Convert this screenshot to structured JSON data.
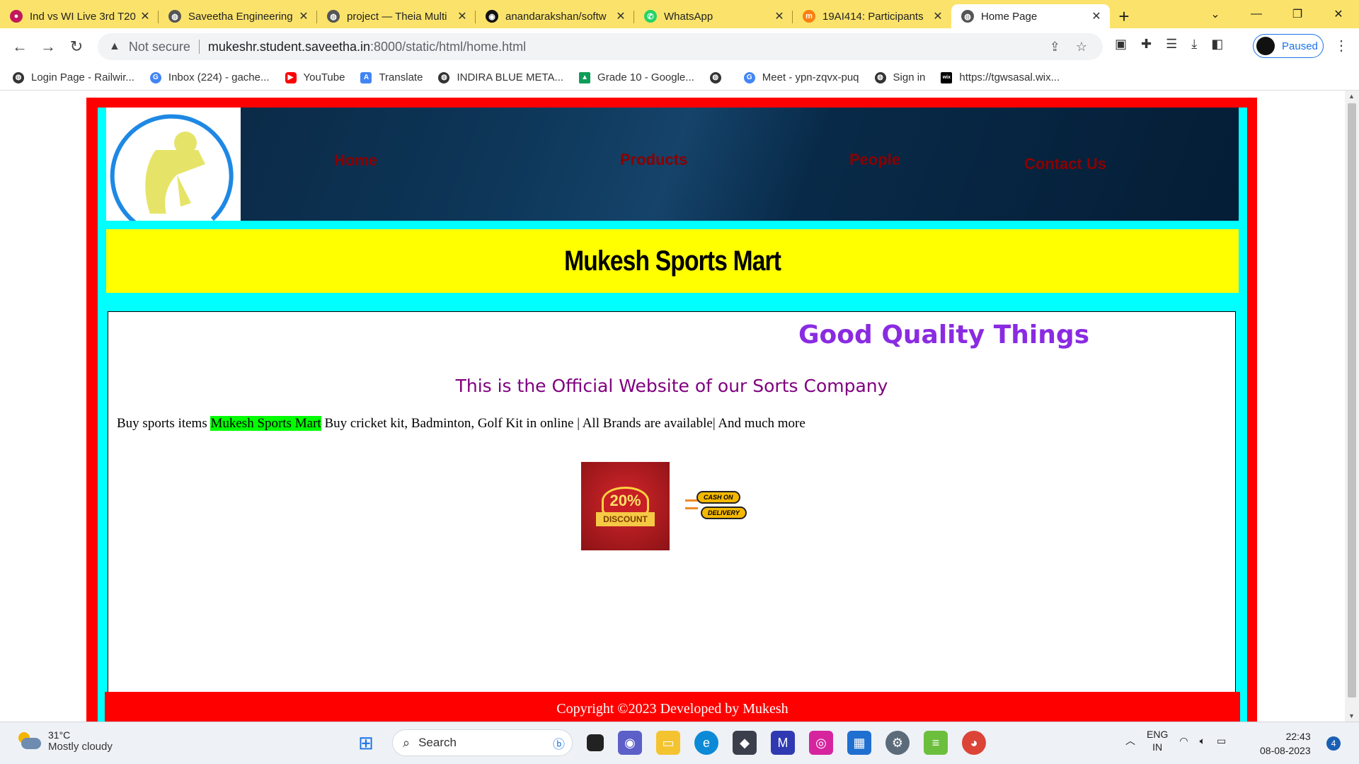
{
  "tabs": [
    {
      "title": "Ind vs WI Live 3rd T20",
      "icon": "cricket-icon",
      "color": "#c2185b"
    },
    {
      "title": "Saveetha Engineering",
      "icon": "globe-icon",
      "color": "#555555"
    },
    {
      "title": "project — Theia Multi",
      "icon": "globe-icon",
      "color": "#555555"
    },
    {
      "title": "anandarakshan/softw",
      "icon": "github-icon",
      "color": "#111111"
    },
    {
      "title": "WhatsApp",
      "icon": "whatsapp-icon",
      "color": "#25d366"
    },
    {
      "title": "19AI414: Participants",
      "icon": "moodle-icon",
      "color": "#f98012"
    },
    {
      "title": "Home Page",
      "icon": "globe-icon",
      "color": "#555555"
    }
  ],
  "address": {
    "security": "Not secure",
    "host": "mukeshr.student.saveetha.in",
    "path": ":8000/static/html/home.html"
  },
  "profile": {
    "status": "Paused"
  },
  "bookmarks": [
    {
      "label": "Login Page - Railwir...",
      "icon": "globe-icon",
      "color": "#333333"
    },
    {
      "label": "Inbox (224) - gache...",
      "icon": "google-icon",
      "color": "#4285f4"
    },
    {
      "label": "YouTube",
      "icon": "youtube-icon",
      "color": "#ff0000"
    },
    {
      "label": "Translate",
      "icon": "translate-icon",
      "color": "#4285f4"
    },
    {
      "label": "INDIRA BLUE META...",
      "icon": "globe-icon",
      "color": "#333333"
    },
    {
      "label": "Grade 10 - Google...",
      "icon": "drive-icon",
      "color": "#0f9d58"
    },
    {
      "label": "",
      "icon": "globe-icon",
      "color": "#333333"
    },
    {
      "label": "Meet - ypn-zqvx-puq",
      "icon": "google-icon",
      "color": "#4285f4"
    },
    {
      "label": "Sign in",
      "icon": "globe-icon",
      "color": "#333333"
    },
    {
      "label": "https://tgwsasal.wix...",
      "icon": "wix-icon",
      "color": "#000000"
    }
  ],
  "site": {
    "nav": [
      "Home",
      "Products",
      "People",
      "Contact Us"
    ],
    "title": "Mukesh Sports Mart",
    "heading": "Good Quality Things",
    "official": "This is the Official Website of our Sorts Company",
    "desc_before": "Buy sports items ",
    "desc_highlight": "Mukesh Sports Mart",
    "desc_after": " Buy cricket kit, Badminton, Golf Kit in online | All Brands are available| And much more",
    "discount_value": "20%",
    "discount_label": "DISCOUNT",
    "cod_top": "CASH ON",
    "cod_bottom": "DELIVERY",
    "footer": "Copyright ©2023 Developed by Mukesh"
  },
  "colors": {
    "outer_border": "#ff0000",
    "inner_frame": "#00ffff",
    "title_band": "#ffff00",
    "heading": "#8a2be2",
    "official": "#800080",
    "nav_link": "#8b0000",
    "highlight": "#00ff00"
  },
  "taskbar": {
    "temperature": "31°C",
    "weather": "Mostly cloudy",
    "search_placeholder": "Search",
    "lang_top": "ENG",
    "lang_bottom": "IN",
    "time": "22:43",
    "date": "08-08-2023",
    "notifications": "4"
  }
}
